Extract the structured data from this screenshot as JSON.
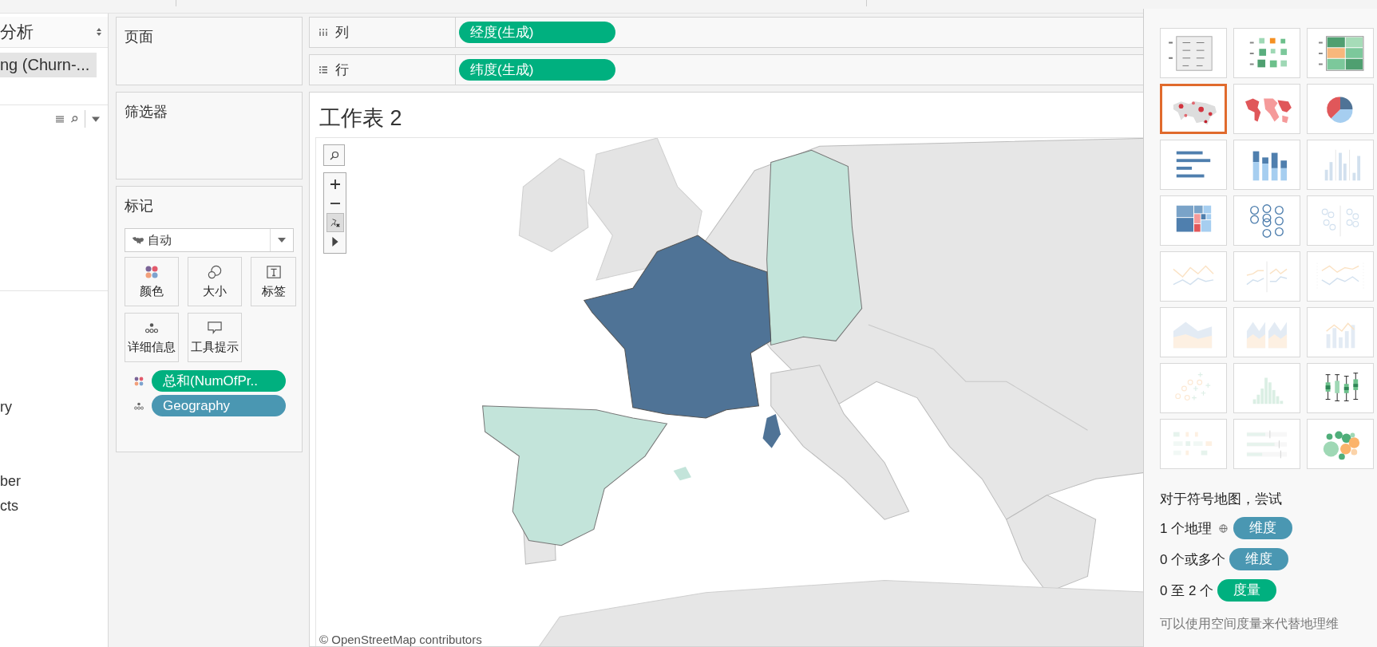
{
  "data_pane": {
    "title": "分析",
    "source": "ng (Churn-...",
    "fields": [
      "ry",
      "ber",
      "cts"
    ]
  },
  "pages_card": {
    "title": "页面"
  },
  "filters_card": {
    "title": "筛选器"
  },
  "marks_card": {
    "title": "标记",
    "mark_type": "自动",
    "buttons": [
      {
        "kind": "color",
        "label": "颜色"
      },
      {
        "kind": "size",
        "label": "大小"
      },
      {
        "kind": "label",
        "label": "标签"
      },
      {
        "kind": "detail",
        "label": "详细信息"
      },
      {
        "kind": "tooltip",
        "label": "工具提示"
      }
    ],
    "fields": [
      {
        "kind": "color",
        "measure": true,
        "label": "总和(NumOfPr.."
      },
      {
        "kind": "detail",
        "measure": false,
        "label": "Geography"
      }
    ]
  },
  "columns_shelf": {
    "label": "列",
    "pills": [
      {
        "kind": "measure",
        "label": "经度(生成)"
      }
    ]
  },
  "rows_shelf": {
    "label": "行",
    "pills": [
      {
        "kind": "measure",
        "label": "纬度(生成)"
      }
    ]
  },
  "sheet": {
    "title": "工作表 2",
    "map": {
      "kind": "picture",
      "attribution": "© OpenStreetMap contributors"
    }
  },
  "show_me": {
    "chart_types": [
      {
        "kind": "text-table",
        "available": true,
        "selected": false
      },
      {
        "kind": "heat-map",
        "available": true,
        "selected": false
      },
      {
        "kind": "highlight-table",
        "available": true,
        "selected": false
      },
      {
        "kind": "symbol-map",
        "available": true,
        "selected": true
      },
      {
        "kind": "filled-map",
        "available": true,
        "selected": false
      },
      {
        "kind": "pie",
        "available": true,
        "selected": false
      },
      {
        "kind": "hbar",
        "available": true,
        "selected": false
      },
      {
        "kind": "stacked-bar",
        "available": true,
        "selected": false
      },
      {
        "kind": "side-by-side-bar",
        "available": false,
        "selected": false
      },
      {
        "kind": "treemap",
        "available": true,
        "selected": false
      },
      {
        "kind": "circle-view",
        "available": true,
        "selected": false
      },
      {
        "kind": "side-by-side-circle",
        "available": false,
        "selected": false
      },
      {
        "kind": "line-continuous",
        "available": false,
        "selected": false
      },
      {
        "kind": "line-discrete",
        "available": false,
        "selected": false
      },
      {
        "kind": "dual-line",
        "available": false,
        "selected": false
      },
      {
        "kind": "area-continuous",
        "available": false,
        "selected": false
      },
      {
        "kind": "area-discrete",
        "available": false,
        "selected": false
      },
      {
        "kind": "dual-combo",
        "available": false,
        "selected": false
      },
      {
        "kind": "scatter",
        "available": false,
        "selected": false
      },
      {
        "kind": "histogram",
        "available": false,
        "selected": false
      },
      {
        "kind": "box-whisker",
        "available": true,
        "selected": false
      },
      {
        "kind": "gantt",
        "available": false,
        "selected": false
      },
      {
        "kind": "bullet",
        "available": false,
        "selected": false
      },
      {
        "kind": "packed-bubbles",
        "available": true,
        "selected": false
      }
    ],
    "hint": "对于符号地图，尝试",
    "requirements": [
      {
        "count": "1 个地理",
        "geo": true,
        "pill": {
          "kind": "dimension",
          "label": "维度"
        }
      },
      {
        "count": "0 个或多个",
        "geo": false,
        "pill": {
          "kind": "dimension",
          "label": "维度"
        }
      },
      {
        "count": "0 至 2 个",
        "geo": false,
        "pill": {
          "kind": "measure",
          "label": "度量"
        }
      }
    ],
    "note": "可以使用空间度量来代替地理维"
  }
}
